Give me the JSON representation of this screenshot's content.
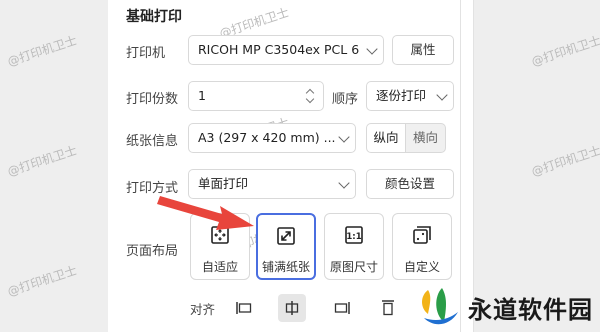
{
  "section": {
    "title": "基础打印"
  },
  "printer": {
    "label": "打印机",
    "value": "RICOH MP C3504ex PCL 6",
    "button": "属性"
  },
  "copies": {
    "label": "打印份数",
    "value": "1",
    "order_label": "顺序",
    "order_value": "逐份打印"
  },
  "paper": {
    "label": "纸张信息",
    "value": "A3 (297 x 420 mm) ...",
    "portrait": "纵向",
    "landscape": "横向"
  },
  "print_mode": {
    "label": "打印方式",
    "value": "单面打印",
    "color_button": "颜色设置"
  },
  "layout": {
    "label": "页面布局",
    "options": [
      {
        "label": "自适应",
        "icon": "fit-icon"
      },
      {
        "label": "铺满纸张",
        "icon": "fill-paper-icon",
        "selected": true
      },
      {
        "label": "原图尺寸",
        "icon": "original-size-icon"
      },
      {
        "label": "自定义",
        "icon": "custom-icon"
      }
    ]
  },
  "align": {
    "label": "对齐"
  },
  "watermark": {
    "text": "@打印机卫士"
  },
  "brand": {
    "text": "永道软件园"
  },
  "colors": {
    "accent": "#4a6ee0",
    "arrow": "#e8453c"
  }
}
